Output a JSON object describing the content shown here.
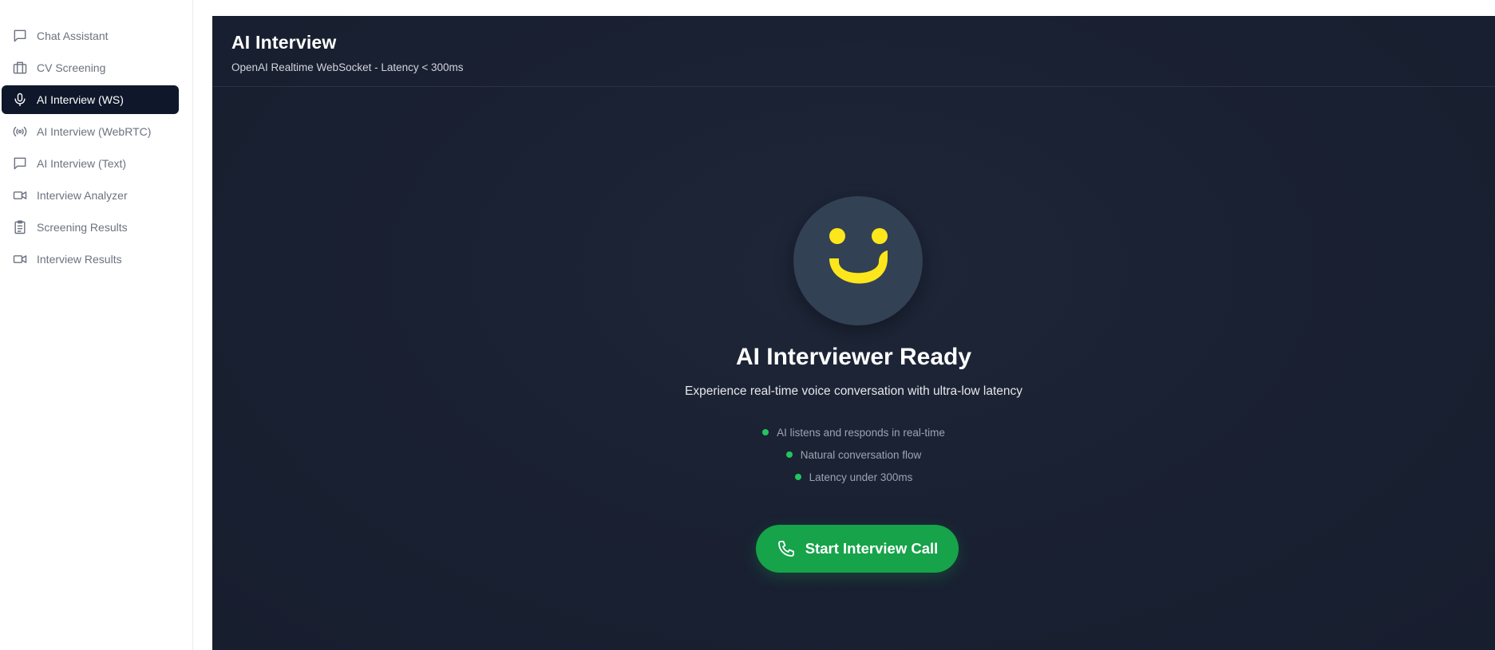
{
  "sidebar": {
    "items": [
      {
        "label": "Chat Assistant",
        "icon": "message-square-icon",
        "active": false
      },
      {
        "label": "CV Screening",
        "icon": "briefcase-icon",
        "active": false
      },
      {
        "label": "AI Interview (WS)",
        "icon": "microphone-icon",
        "active": true
      },
      {
        "label": "AI Interview (WebRTC)",
        "icon": "radio-broadcast-icon",
        "active": false
      },
      {
        "label": "AI Interview (Text)",
        "icon": "message-square-icon",
        "active": false
      },
      {
        "label": "Interview Analyzer",
        "icon": "video-camera-icon",
        "active": false
      },
      {
        "label": "Screening Results",
        "icon": "clipboard-list-icon",
        "active": false
      },
      {
        "label": "Interview Results",
        "icon": "video-camera-icon",
        "active": false
      }
    ]
  },
  "header": {
    "title": "AI Interview",
    "subtitle": "OpenAI Realtime WebSocket - Latency < 300ms"
  },
  "main": {
    "avatar_icon": "smiley-face-icon",
    "title": "AI Interviewer Ready",
    "description": "Experience real-time voice conversation with ultra-low latency",
    "features": [
      "AI listens and responds in real-time",
      "Natural conversation flow",
      "Latency under 300ms"
    ],
    "start_button": "Start Interview Call"
  },
  "colors": {
    "sidebar_active_bg": "#0f172a",
    "panel_bg": "#1a2133",
    "accent_green": "#16a34a",
    "dot_green": "#22c55e",
    "avatar_bg": "#334155",
    "avatar_face": "#fde61b"
  }
}
